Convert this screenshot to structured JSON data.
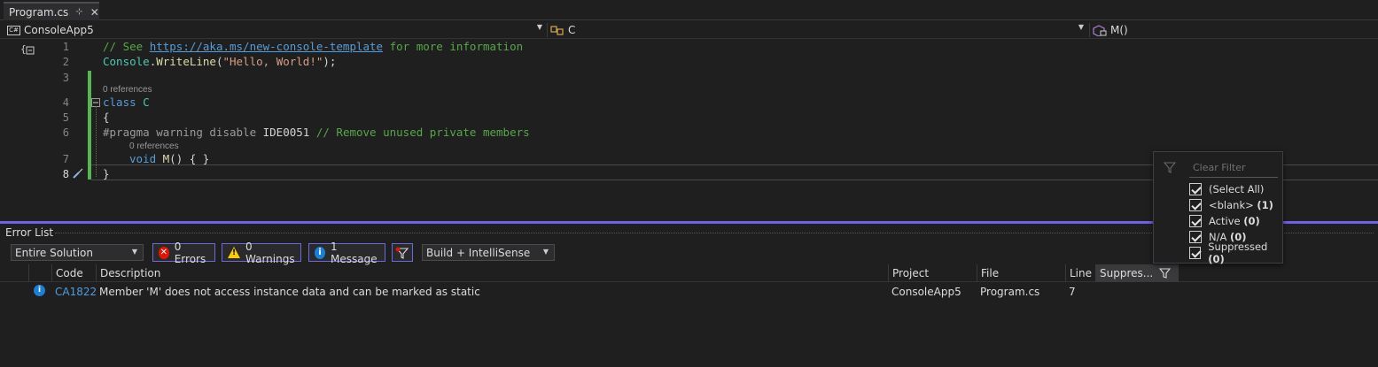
{
  "tab": {
    "title": "Program.cs",
    "pin_glyph": "⊹",
    "close_glyph": "✕"
  },
  "navbar": {
    "project": "ConsoleApp5",
    "project_badge": "C#",
    "type": "C",
    "member": "M()"
  },
  "editor": {
    "lines": [
      {
        "num": "1",
        "comment_prefix": "// See ",
        "link": "https://aka.ms/new-console-template",
        "comment_suffix": " for more information"
      },
      {
        "num": "2",
        "obj": "Console",
        "dot": ".",
        "method": "WriteLine",
        "open": "(",
        "str": "\"Hello, World!\"",
        "close": ");"
      },
      {
        "num": "3"
      },
      {
        "num": "4",
        "kw": "class",
        "name": "C"
      },
      {
        "num": "5",
        "text": "{"
      },
      {
        "num": "6",
        "pragma": "#pragma warning disable",
        "id": "IDE0051",
        "comment": "// Remove unused private members"
      },
      {
        "num": "7",
        "kw": "void",
        "method": "M",
        "rest": "() { }"
      },
      {
        "num": "8",
        "text": "}"
      }
    ],
    "lens_class": "0 references",
    "lens_method": "0 references"
  },
  "errorlist": {
    "title": "Error List",
    "scope": "Entire Solution",
    "errors": "0 Errors",
    "warnings": "0 Warnings",
    "messages": "1 Message",
    "build_filter": "Build + IntelliSense",
    "columns": {
      "code": "Code",
      "description": "Description",
      "project": "Project",
      "file": "File",
      "line": "Line",
      "suppression": "Suppres..."
    },
    "rows": [
      {
        "code": "CA1822",
        "description": "Member 'M' does not access instance data and can be marked as static",
        "project": "ConsoleApp5",
        "file": "Program.cs",
        "line": "7"
      }
    ]
  },
  "filter_popup": {
    "clear": "Clear Filter",
    "options": [
      {
        "label": "(Select All)",
        "count": "",
        "checked": true
      },
      {
        "label": "<blank>",
        "count": "(1)",
        "checked": true
      },
      {
        "label": "Active",
        "count": "(0)",
        "checked": true
      },
      {
        "label": "N/A",
        "count": "(0)",
        "checked": true
      },
      {
        "label": "Suppressed",
        "count": "(0)",
        "checked": true
      }
    ]
  },
  "colors": {
    "accent": "#7160e8",
    "changebar": "#56b64f",
    "info": "#1c7fd6",
    "error": "#e51400",
    "warning": "#ffcc00"
  }
}
